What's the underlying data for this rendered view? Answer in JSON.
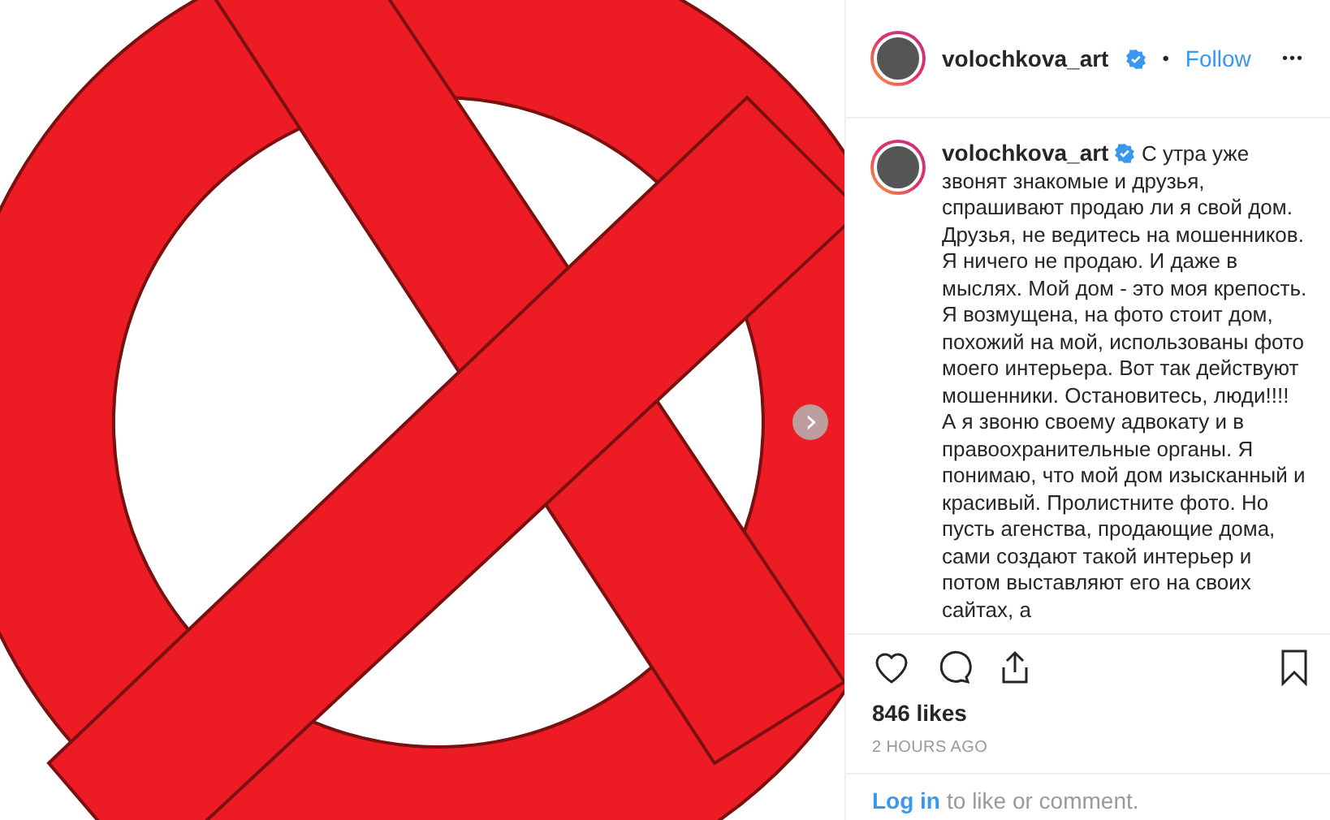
{
  "post": {
    "next_button": "›"
  },
  "header": {
    "username": "volochkova_art",
    "verified": true,
    "separator": "•",
    "follow": "Follow",
    "more": "•••"
  },
  "caption": {
    "username": "volochkova_art",
    "verified": true,
    "text": "С утра уже звонят знакомые и друзья, спрашивают продаю ли я свой дом. Друзья, не ведитесь на мошенников. Я ничего не продаю. И даже в мыслях. Мой дом - это моя крепость. Я возмущена, на фото стоит дом, похожий на мой, использованы фото моего интерьера. Вот так действуют мошенники. Остановитесь, люди!!!! А я звоню своему адвокату и в правоохранительные органы. Я понимаю, что мой дом изысканный и красивый. Пролистните фото. Но пусть агенства, продающие дома, сами создают такой интерьер и потом выставляют его на своих сайтах, а"
  },
  "likes": "846 likes",
  "time": "2 HOURS AGO",
  "login": {
    "link": "Log in",
    "rest": "to like or comment."
  }
}
